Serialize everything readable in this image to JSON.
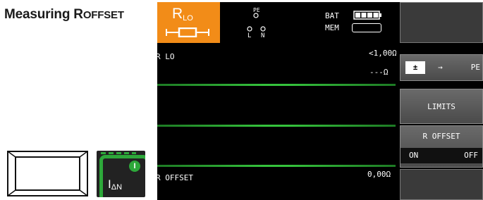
{
  "heading": {
    "prefix": "Measuring R",
    "suffix": "OFFSET"
  },
  "keys": {
    "idn_label": "I",
    "idn_sub": "ΔN",
    "idn_led": "I"
  },
  "screen": {
    "mode_title": "R",
    "mode_sub": "LO",
    "conn_top": "PE",
    "conn_left": "L",
    "conn_right": "N",
    "bat_label": "BAT",
    "mem_label": "MEM",
    "rlo_label": "R LO",
    "rlo_limit": "<1,00Ω",
    "rlo_value": "---Ω",
    "offset_label": "R OFFSET",
    "offset_value": "0,00Ω"
  },
  "softkeys": {
    "pe_pm": "±",
    "pe_arrow": "→",
    "pe_label": "PE",
    "limits": "LIMITS",
    "roffset_title": "R OFFSET",
    "on": "ON",
    "off": "OFF"
  }
}
